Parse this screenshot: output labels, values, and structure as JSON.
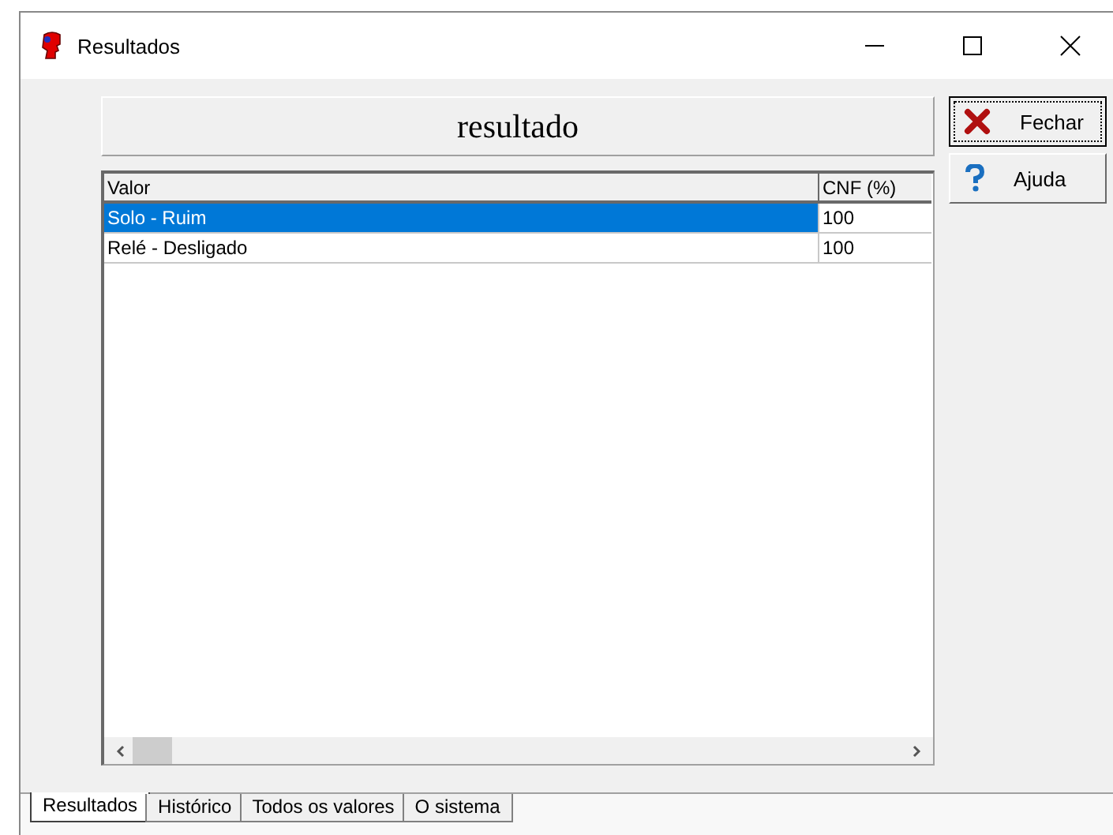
{
  "window": {
    "title": "Resultados"
  },
  "header": "resultado",
  "table": {
    "columns": [
      "Valor",
      "CNF (%)"
    ],
    "rows": [
      {
        "cells": [
          "Solo - Ruim",
          "100"
        ],
        "selected": true
      },
      {
        "cells": [
          "Relé - Desligado",
          "100"
        ],
        "selected": false
      }
    ]
  },
  "buttons": [
    {
      "label": "Fechar",
      "kind": "close",
      "focused": true
    },
    {
      "label": "Ajuda",
      "kind": "help",
      "focused": false
    }
  ],
  "tabs": [
    {
      "label": "Resultados",
      "selected": true
    },
    {
      "label": "Histórico",
      "selected": false
    },
    {
      "label": "Todos os valores",
      "selected": false
    },
    {
      "label": "O sistema",
      "selected": false
    }
  ]
}
